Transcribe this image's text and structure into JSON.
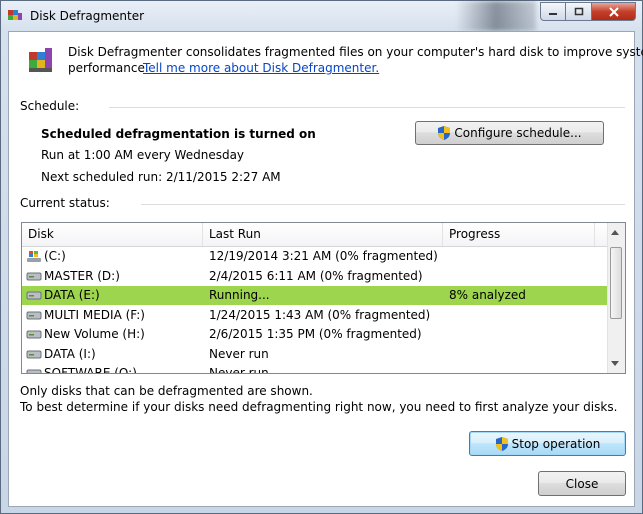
{
  "window": {
    "title": "Disk Defragmenter"
  },
  "intro": {
    "text": "Disk Defragmenter consolidates fragmented files on your computer's hard disk to improve system",
    "text2": "performance.",
    "link": "Tell me more about Disk Defragmenter."
  },
  "schedule": {
    "heading": "Schedule:",
    "status": "Scheduled defragmentation is turned on",
    "run_at": "Run at 1:00 AM every Wednesday",
    "next_run": "Next scheduled run: 2/11/2015 2:27 AM",
    "configure_label": "Configure schedule..."
  },
  "current_status": {
    "heading": "Current status:",
    "columns": [
      "Disk",
      "Last Run",
      "Progress"
    ],
    "rows": [
      {
        "disk": "(C:)",
        "last_run": "12/19/2014 3:21 AM (0% fragmented)",
        "progress": "",
        "icon": "windows-drive-icon"
      },
      {
        "disk": "MASTER (D:)",
        "last_run": "2/4/2015 6:11 AM (0% fragmented)",
        "progress": "",
        "icon": "drive-icon"
      },
      {
        "disk": "DATA (E:)",
        "last_run": "Running...",
        "progress": "8% analyzed",
        "icon": "drive-icon",
        "selected": true
      },
      {
        "disk": "MULTI MEDIA (F:)",
        "last_run": "1/24/2015 1:43 AM (0% fragmented)",
        "progress": "",
        "icon": "drive-icon"
      },
      {
        "disk": "New Volume (H:)",
        "last_run": "2/6/2015 1:35 PM (0% fragmented)",
        "progress": "",
        "icon": "drive-icon"
      },
      {
        "disk": "DATA (I:)",
        "last_run": "Never run",
        "progress": "",
        "icon": "drive-icon"
      },
      {
        "disk": "SOFTWARE (O:)",
        "last_run": "Never run",
        "progress": "",
        "icon": "drive-icon"
      }
    ]
  },
  "notes": {
    "line1": "Only disks that can be defragmented are shown.",
    "line2": "To best determine if your disks need defragmenting right now, you need to first analyze your disks."
  },
  "actions": {
    "stop_label": "Stop operation",
    "close_label": "Close"
  },
  "colors": {
    "selection": "#9ed54e",
    "link": "#0645c8"
  }
}
